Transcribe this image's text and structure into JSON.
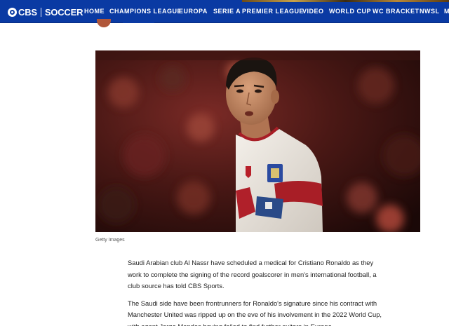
{
  "header": {
    "logo_brand": "CBS",
    "logo_section": "SOCCER",
    "nav": [
      "HOME",
      "CHAMPIONS LEAGUE",
      "EUROPA",
      "SERIE A",
      "PREMIER LEAGUE",
      "VIDEO",
      "WORLD CUP",
      "WC BRACKET",
      "NWSL",
      "MI"
    ],
    "bg_color": "#0a3aa3"
  },
  "photo": {
    "credit": "Getty Images"
  },
  "article": {
    "paragraphs": [
      "Saudi Arabian club Al Nassr have scheduled a medical for Cristiano Ronaldo as they work to complete the signing of the record goalscorer in men's international football, a club source has told CBS Sports.",
      "The Saudi side have been frontrunners for Ronaldo's signature since his contract with Manchester United was ripped up on the eve of his involvement in the 2022 World Cup, with agent Jorge Mendes having failed to find further suitors in Europe."
    ]
  }
}
